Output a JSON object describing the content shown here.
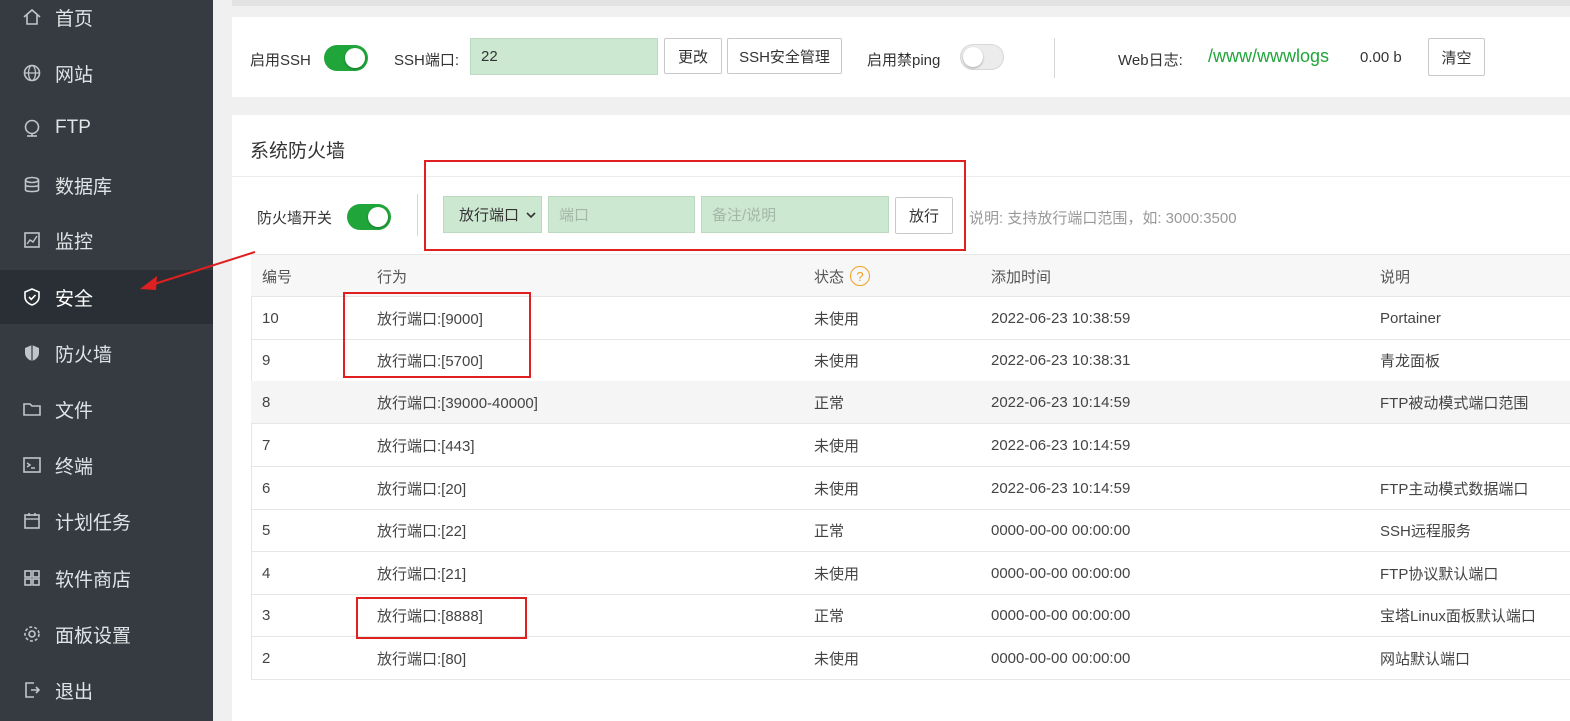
{
  "sidebar": {
    "items": [
      {
        "label": "首页",
        "icon": "home-icon"
      },
      {
        "label": "网站",
        "icon": "globe-icon"
      },
      {
        "label": "FTP",
        "icon": "ftp-icon"
      },
      {
        "label": "数据库",
        "icon": "database-icon"
      },
      {
        "label": "监控",
        "icon": "monitor-icon"
      },
      {
        "label": "安全",
        "icon": "shield-check-icon",
        "active": true
      },
      {
        "label": "防火墙",
        "icon": "firewall-shield-icon"
      },
      {
        "label": "文件",
        "icon": "folder-icon"
      },
      {
        "label": "终端",
        "icon": "terminal-icon"
      },
      {
        "label": "计划任务",
        "icon": "calendar-icon"
      },
      {
        "label": "软件商店",
        "icon": "grid-icon"
      },
      {
        "label": "面板设置",
        "icon": "gear-icon"
      },
      {
        "label": "退出",
        "icon": "logout-icon"
      }
    ]
  },
  "ssh_bar": {
    "enable_ssh_label": "启用SSH",
    "enable_ssh_on": true,
    "ssh_port_label": "SSH端口:",
    "ssh_port_value": "22",
    "change_button": "更改",
    "ssh_manage_button": "SSH安全管理",
    "disable_ping_label": "启用禁ping",
    "disable_ping_on": false,
    "web_log_label": "Web日志:",
    "web_log_path": "/www/wwwlogs",
    "web_log_size": "0.00 b",
    "clear_button": "清空"
  },
  "firewall": {
    "title": "系统防火墙",
    "switch_label": "防火墙开关",
    "switch_on": true,
    "action_select": "放行端口",
    "port_placeholder": "端口",
    "note_placeholder": "备注/说明",
    "allow_button": "放行",
    "hint": "说明: 支持放行端口范围，如: 3000:3500"
  },
  "table": {
    "headers": {
      "id": "编号",
      "action": "行为",
      "status": "状态",
      "time": "添加时间",
      "note": "说明"
    },
    "help_mark": "?",
    "rows": [
      {
        "id": "10",
        "action": "放行端口:[9000]",
        "status": "未使用",
        "time": "2022-06-23 10:38:59",
        "note": "Portainer"
      },
      {
        "id": "9",
        "action": "放行端口:[5700]",
        "status": "未使用",
        "time": "2022-06-23 10:38:31",
        "note": "青龙面板"
      },
      {
        "id": "8",
        "action": "放行端口:[39000-40000]",
        "status": "正常",
        "time": "2022-06-23 10:14:59",
        "note": "FTP被动模式端口范围"
      },
      {
        "id": "7",
        "action": "放行端口:[443]",
        "status": "未使用",
        "time": "2022-06-23 10:14:59",
        "note": ""
      },
      {
        "id": "6",
        "action": "放行端口:[20]",
        "status": "未使用",
        "time": "2022-06-23 10:14:59",
        "note": "FTP主动模式数据端口"
      },
      {
        "id": "5",
        "action": "放行端口:[22]",
        "status": "正常",
        "time": "0000-00-00 00:00:00",
        "note": "SSH远程服务"
      },
      {
        "id": "4",
        "action": "放行端口:[21]",
        "status": "未使用",
        "time": "0000-00-00 00:00:00",
        "note": "FTP协议默认端口"
      },
      {
        "id": "3",
        "action": "放行端口:[8888]",
        "status": "正常",
        "time": "0000-00-00 00:00:00",
        "note": "宝塔Linux面板默认端口"
      },
      {
        "id": "2",
        "action": "放行端口:[80]",
        "status": "未使用",
        "time": "0000-00-00 00:00:00",
        "note": "网站默认端口"
      }
    ]
  },
  "colors": {
    "sidebar_bg": "#363b41",
    "sidebar_active": "#2a2f35",
    "toggle_on": "#20a53a",
    "input_green": "#cde8d1",
    "annotation_red": "#e02020",
    "log_path_green": "#20a53a"
  }
}
